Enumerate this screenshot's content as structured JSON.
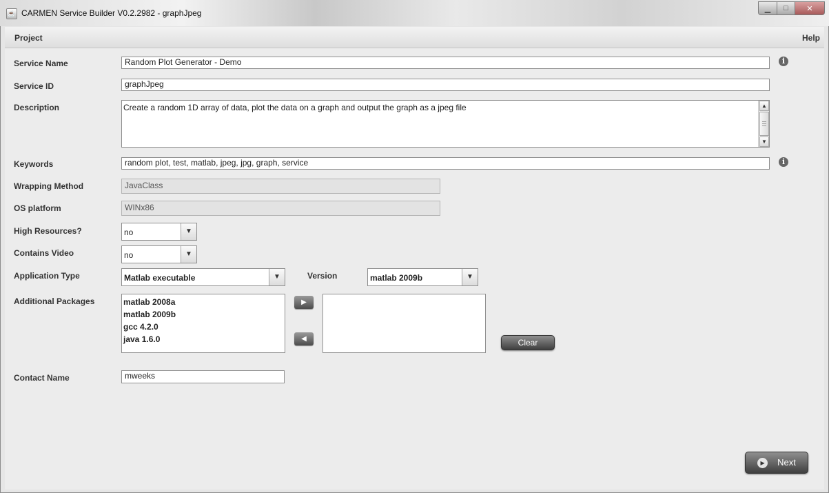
{
  "window": {
    "title": "CARMEN Service Builder V0.2.2982  - graphJpeg"
  },
  "menu": {
    "project": "Project",
    "help": "Help"
  },
  "form": {
    "service_name": {
      "label": "Service Name",
      "value": "Random Plot Generator - Demo"
    },
    "service_id": {
      "label": "Service ID",
      "value": "graphJpeg"
    },
    "description": {
      "label": "Description",
      "value": "Create a random 1D array of data, plot the data on a graph and output the graph as a jpeg file"
    },
    "keywords": {
      "label": "Keywords",
      "value": "random plot, test, matlab, jpeg, jpg, graph, service"
    },
    "wrapping_method": {
      "label": "Wrapping Method",
      "value": "JavaClass"
    },
    "os_platform": {
      "label": "OS platform",
      "value": "WINx86"
    },
    "high_resources": {
      "label": "High Resources?",
      "value": "no"
    },
    "contains_video": {
      "label": "Contains Video",
      "value": "no"
    },
    "application_type": {
      "label": "Application Type",
      "value": "Matlab executable"
    },
    "version": {
      "label": "Version",
      "value": "matlab 2009b"
    },
    "additional_packages": {
      "label": "Additional Packages",
      "available": [
        "matlab 2008a",
        "matlab 2009b",
        "gcc 4.2.0",
        "java 1.6.0"
      ],
      "selected": []
    },
    "clear_label": "Clear",
    "contact_name": {
      "label": "Contact Name",
      "value": "mweeks"
    }
  },
  "footer": {
    "next_label": "Next"
  },
  "icons": {
    "info": "info-icon",
    "dropdown": "chevron-down-icon",
    "add": "arrow-right-icon",
    "remove": "arrow-left-icon",
    "next": "play-circle-icon"
  }
}
